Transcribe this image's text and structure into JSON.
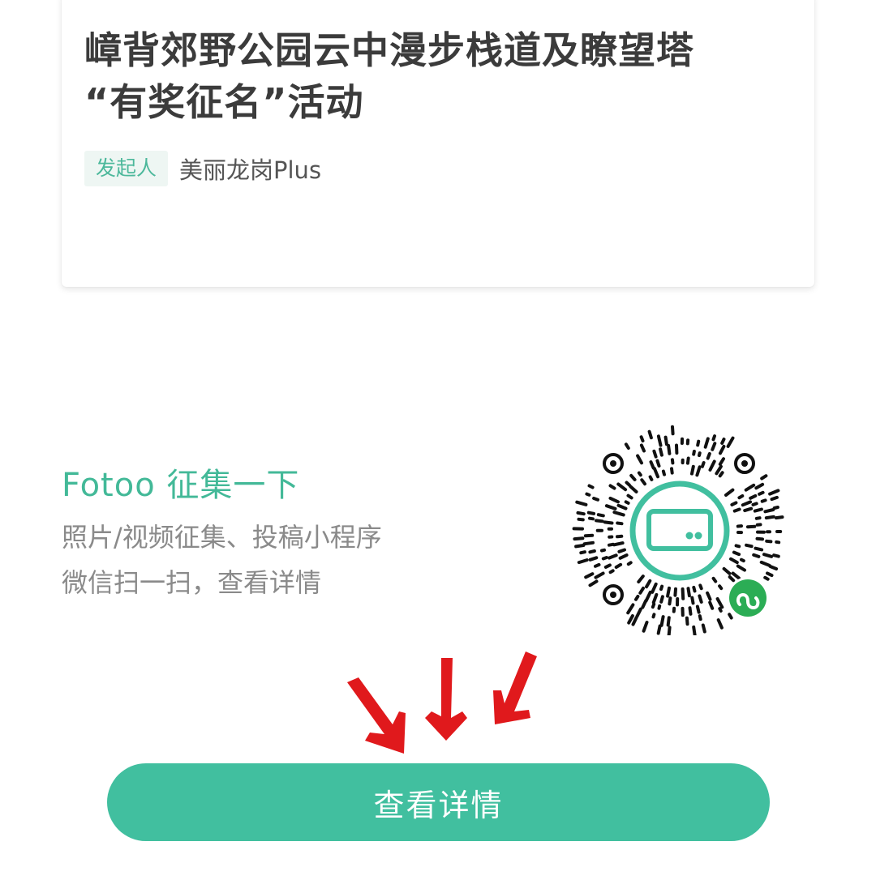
{
  "card": {
    "title_line1": "嶂背郊野公园云中漫步栈道及瞭望塔",
    "title_line2": "“有奖征名”活动",
    "initiator_label": "发起人",
    "initiator_name": "美丽龙岗Plus"
  },
  "promo": {
    "title": "Fotoo 征集一下",
    "line1": "照片/视频征集、投稿小程序",
    "line2": "微信扫一扫，查看详情"
  },
  "qr_code": {
    "center_icon": "card-icon",
    "badge_icon": "mini-program-icon"
  },
  "annotation": {
    "icon": "red-arrow-icon",
    "count": 3
  },
  "button": {
    "label": "查看详情"
  },
  "colors": {
    "accent": "#41bf9f",
    "annotation": "#e0191c"
  }
}
